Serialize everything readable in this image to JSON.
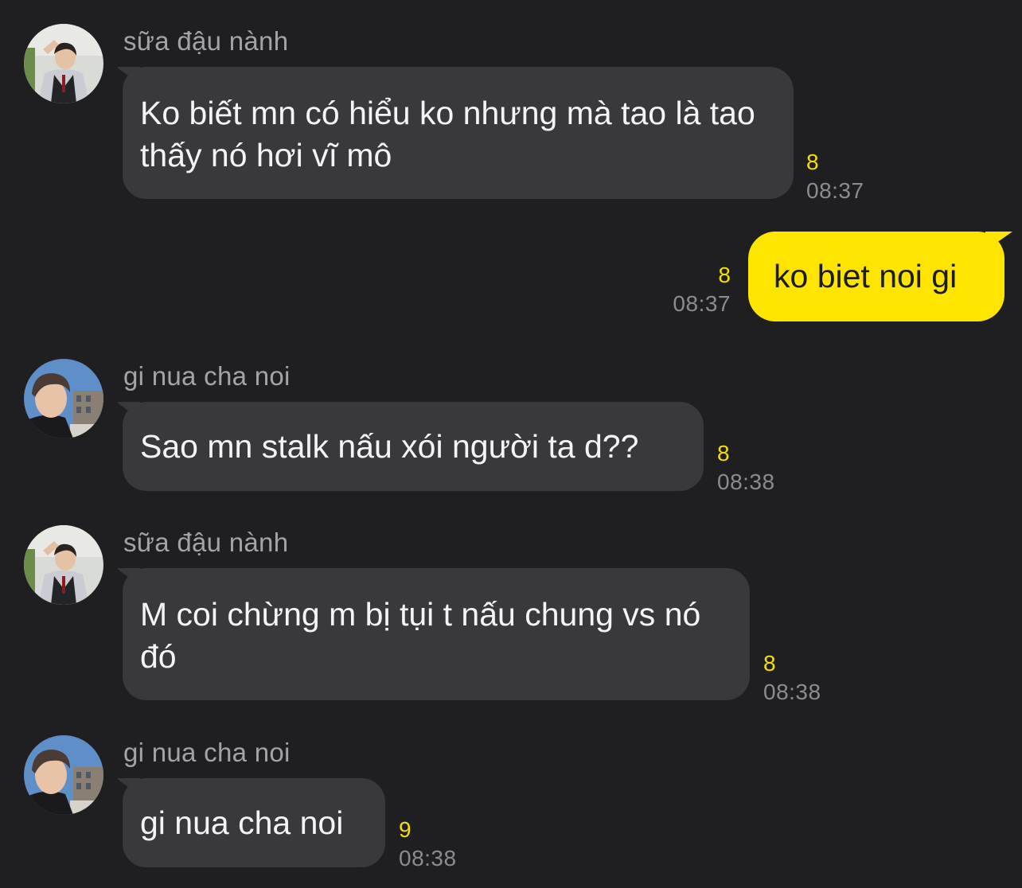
{
  "messages": [
    {
      "sender": "sữa đậu nành",
      "avatar": "avatar-boy-school-uniform",
      "text": "Ko biết mn có hiểu ko nhưng mà tao là tao thấy nó hơi vĩ mô",
      "unread": "8",
      "time": "08:37"
    },
    {
      "outgoing": true,
      "text": "ko biet noi gi",
      "unread": "8",
      "time": "08:37"
    },
    {
      "sender": "gi nua cha noi",
      "avatar": "avatar-young-man-outdoor",
      "text": "Sao mn stalk nấu xói người ta d??",
      "unread": "8",
      "time": "08:38"
    },
    {
      "sender": "sữa đậu nành",
      "avatar": "avatar-boy-school-uniform",
      "text": "M coi chừng m bị tụi t nấu chung vs nó đó",
      "unread": "8",
      "time": "08:38"
    },
    {
      "sender": "gi nua cha noi",
      "avatar": "avatar-young-man-outdoor",
      "text": "gi nua cha noi",
      "unread": "9",
      "time": "08:38"
    }
  ],
  "colors": {
    "background": "#1f1f21",
    "incoming_bubble": "#39393c",
    "outgoing_bubble": "#fee500",
    "unread_count": "#f3e000",
    "timestamp": "#8c8c90",
    "sender_name": "#a4a4a8"
  }
}
